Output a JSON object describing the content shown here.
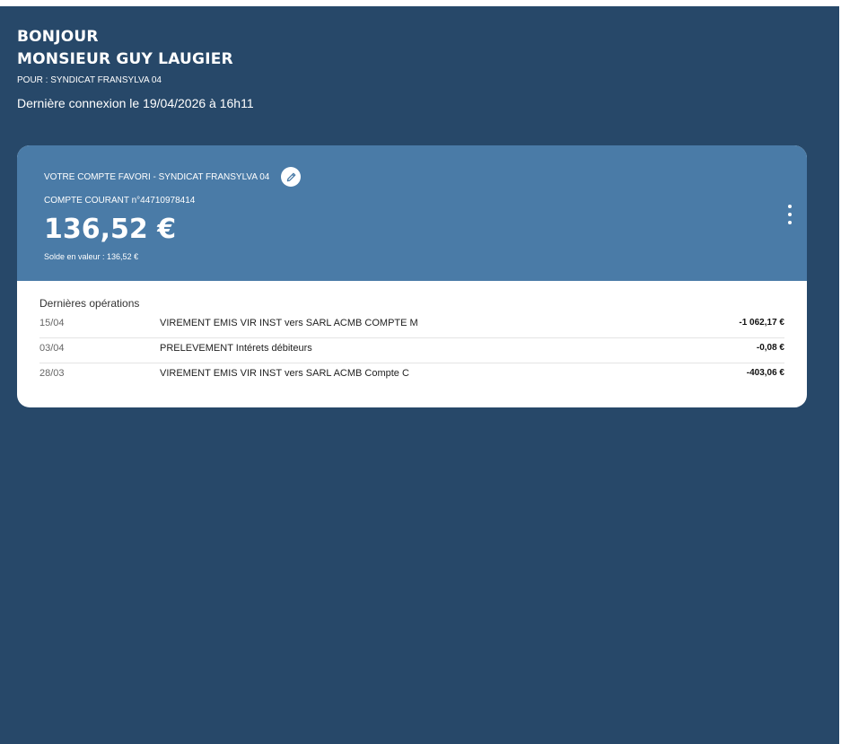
{
  "header": {
    "greeting_line1": "BONJOUR",
    "greeting_line2": "MONSIEUR GUY LAUGIER",
    "for_line": "POUR : SYNDICAT FRANSYLVA 04",
    "last_login": "Dernière connexion le 19/04/2026 à 16h11"
  },
  "account_card": {
    "favorite_label": "VOTRE COMPTE FAVORI - SYNDICAT FRANSYLVA 04",
    "account_line": "COMPTE COURANT n°44710978414",
    "balance": "136,52 €",
    "value_balance": "Solde en valeur : 136,52 €",
    "edit_icon": "pencil-icon",
    "menu_icon": "vertical-ellipsis-icon"
  },
  "operations": {
    "title": "Dernières opérations",
    "items": [
      {
        "date": "15/04",
        "label": "VIREMENT EMIS VIR INST vers SARL ACMB COMPTE M",
        "amount": "-1 062,17 €"
      },
      {
        "date": "03/04",
        "label": "PRELEVEMENT Intérets débiteurs",
        "amount": "-0,08 €"
      },
      {
        "date": "28/03",
        "label": "VIREMENT EMIS VIR INST vers SARL ACMB Compte C",
        "amount": "-403,06 €"
      }
    ]
  },
  "colors": {
    "page_background": "#274869",
    "card_header": "#4a7ba7",
    "card_body": "#ffffff"
  }
}
